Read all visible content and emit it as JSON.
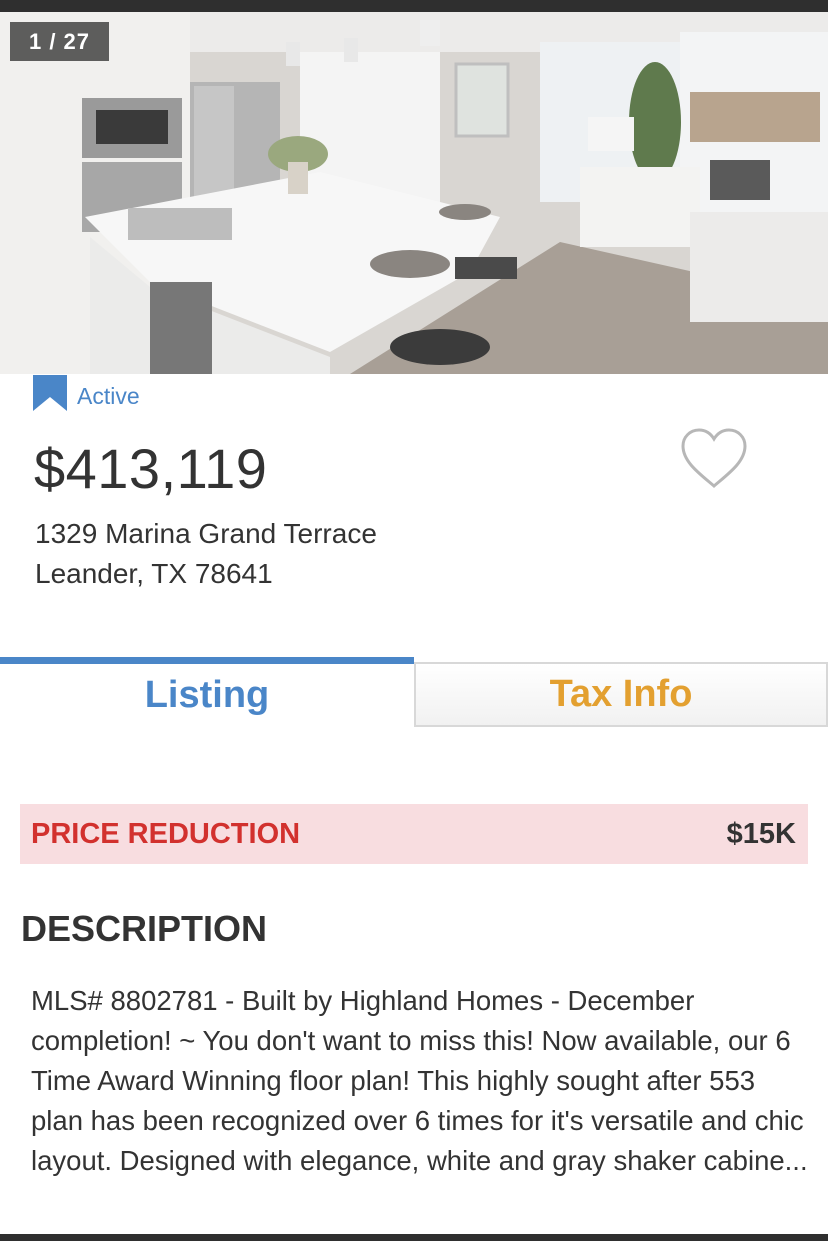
{
  "gallery": {
    "counter": "1 / 27"
  },
  "listing": {
    "status": "Active",
    "price": "$413,119",
    "address_line1": "1329 Marina Grand Terrace",
    "address_line2": "Leander, TX 78641"
  },
  "tabs": [
    {
      "label": "Listing",
      "active": true
    },
    {
      "label": "Tax Info",
      "active": false
    }
  ],
  "price_reduction": {
    "label": "PRICE REDUCTION",
    "amount": "$15K"
  },
  "description": {
    "heading": "DESCRIPTION",
    "text": "MLS# 8802781 - Built by Highland Homes - December completion! ~ You don't want to miss this! Now available, our 6 Time Award Winning floor plan! This highly sought after 553 plan has been recognized over 6 times for it's versatile and chic layout. Designed with elegance, white and gray shaker cabine..."
  },
  "icons": {
    "status": "bookmark-icon",
    "favorite": "heart-outline-icon"
  },
  "colors": {
    "accent_blue": "#4a86c8",
    "tax_orange": "#e3a030",
    "reduction_red": "#d2312e",
    "reduction_bg": "#f8dde0"
  }
}
